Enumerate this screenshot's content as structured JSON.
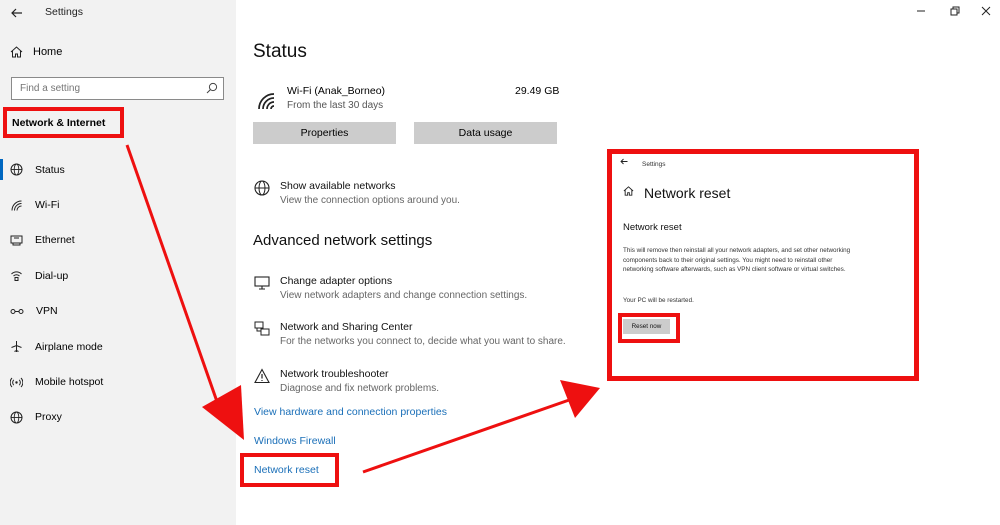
{
  "window": {
    "title": "Settings"
  },
  "sidebar": {
    "home_label": "Home",
    "search_placeholder": "Find a setting",
    "category": "Network & Internet",
    "items": [
      {
        "label": "Status",
        "icon": "globe-icon",
        "selected": true
      },
      {
        "label": "Wi-Fi",
        "icon": "wifi-icon"
      },
      {
        "label": "Ethernet",
        "icon": "ethernet-icon"
      },
      {
        "label": "Dial-up",
        "icon": "dialup-icon"
      },
      {
        "label": "VPN",
        "icon": "vpn-icon"
      },
      {
        "label": "Airplane mode",
        "icon": "airplane-icon"
      },
      {
        "label": "Mobile hotspot",
        "icon": "hotspot-icon"
      },
      {
        "label": "Proxy",
        "icon": "proxy-globe-icon"
      }
    ]
  },
  "main": {
    "title": "Status",
    "network": {
      "name": "Wi-Fi (Anak_Borneo)",
      "subtitle": "From the last 30 days",
      "usage": "29.49 GB"
    },
    "buttons": {
      "properties": "Properties",
      "data_usage": "Data usage"
    },
    "show_networks": {
      "title": "Show available networks",
      "desc": "View the connection options around you."
    },
    "advanced_title": "Advanced network settings",
    "options": [
      {
        "title": "Change adapter options",
        "desc": "View network adapters and change connection settings."
      },
      {
        "title": "Network and Sharing Center",
        "desc": "For the networks you connect to, decide what you want to share."
      },
      {
        "title": "Network troubleshooter",
        "desc": "Diagnose and fix network problems."
      }
    ],
    "links": {
      "hardware": "View hardware and connection properties",
      "firewall": "Windows Firewall",
      "reset": "Network reset"
    }
  },
  "inset": {
    "title": "Settings",
    "page_title": "Network reset",
    "heading": "Network reset",
    "description": "This will remove then reinstall all your network adapters, and set other networking components back to their original settings. You might need to reinstall other networking software afterwards, such as VPN client software or virtual switches.",
    "restart_note": "Your PC will be restarted.",
    "reset_button": "Reset now"
  },
  "colors": {
    "highlight": "#ee1010",
    "accent": "#0067c0",
    "link": "#1a6fb8"
  }
}
